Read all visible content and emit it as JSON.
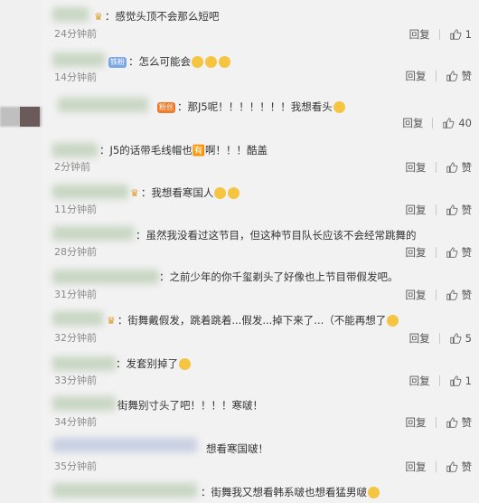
{
  "colors": {
    "panel_bg": "#f2f2f2",
    "text": "#333333",
    "muted": "#8a8a8a"
  },
  "labels": {
    "reply": "回复",
    "like": "赞"
  },
  "comments": [
    {
      "text": "：感觉头顶不会那么短吧",
      "time": "24分钟前",
      "likes": "1"
    },
    {
      "text": "：怎么可能会",
      "time": "14分钟前",
      "likes": "赞"
    },
    {
      "text": "：那J5呢！！！！！！！我想看头",
      "time": "",
      "likes": "40"
    },
    {
      "text": "：J5的话带毛线帽也🈶啊！！！酷盖",
      "time": "2分钟前",
      "likes": "赞"
    },
    {
      "text": "：我想看寒国人",
      "time": "11分钟前",
      "likes": "赞"
    },
    {
      "text": "：虽然我没看过这节目，但这种节目队长应该不会经常跳舞的",
      "time": "28分钟前",
      "likes": "赞"
    },
    {
      "text": "：之前少年的你千玺剃头了好像也上节目带假发吧。",
      "time": "31分钟前",
      "likes": "赞"
    },
    {
      "text": "：街舞戴假发，跳着跳着...假发...掉下来了...（不能再想了",
      "time": "32分钟前",
      "likes": "5"
    },
    {
      "text": "：发套别掉了",
      "time": "33分钟前",
      "likes": "1"
    },
    {
      "text": "街舞别寸头了吧！！！！寒啵！",
      "time": "34分钟前",
      "likes": "赞"
    },
    {
      "text": "想看寒国啵！",
      "time": "35分钟前",
      "likes": "赞"
    },
    {
      "text": "：街舞我又想看韩系啵也想看猛男啵",
      "time": "",
      "likes": ""
    }
  ],
  "badge_iron": "铁粉",
  "badge_fan": "粉丝"
}
